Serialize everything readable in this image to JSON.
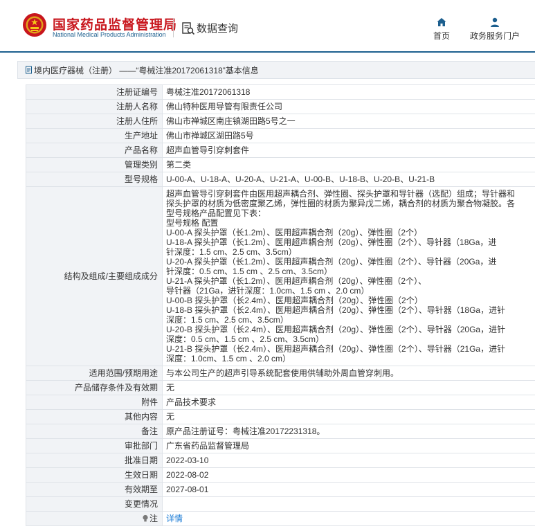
{
  "header": {
    "brand_cn": "国家药品监督管理局",
    "brand_en": "National Medical Products Administration",
    "data_query": "数据查询",
    "nav": {
      "home": "首页",
      "portal": "政务服务门户"
    }
  },
  "title_bar": {
    "text": "境内医疗器械（注册） ——“粤械注准20172061318”基本信息"
  },
  "rows": [
    {
      "label": "注册证编号",
      "value": "粤械注准20172061318"
    },
    {
      "label": "注册人名称",
      "value": "佛山特种医用导管有限责任公司"
    },
    {
      "label": "注册人住所",
      "value": "佛山市禅城区南庄镇湖田路5号之一"
    },
    {
      "label": "生产地址",
      "value": "佛山市禅城区湖田路5号"
    },
    {
      "label": "产品名称",
      "value": "超声血管导引穿刺套件"
    },
    {
      "label": "管理类别",
      "value": "第二类"
    },
    {
      "label": "型号规格",
      "value": "U-00-A、U-18-A、U-20-A、U-21-A、U-00-B、U-18-B、U-20-B、U-21-B"
    }
  ],
  "structure": {
    "label": "结构及组成/主要组成成分",
    "lines": [
      "超声血管导引穿刺套件由医用超声耦合剂、弹性圈、探头护罩和导针器（选配）组成；导针器和",
      "探头护罩的材质为低密度聚乙烯，弹性圈的材质为聚异戊二烯，耦合剂的材质为聚合物凝胶。各",
      "型号规格产品配置见下表：",
      "型号规格 配置",
      "U-00-A 探头护罩（长1.2m）、医用超声耦合剂（20g）、弹性圈（2个）",
      "U-18-A 探头护罩（长1.2m）、医用超声耦合剂（20g）、弹性圈（2个）、导针器（18Ga，进",
      "针深度：1.5 cm、2.5 cm、3.5cm）",
      "U-20-A 探头护罩（长1.2m）、医用超声耦合剂（20g）、弹性圈（2个）、导针器（20Ga，进",
      "针深度：0.5 cm、1.5 cm 、2.5 cm、3.5cm）",
      "U-21-A 探头护罩（长1.2m）、医用超声耦合剂（20g）、弹性圈（2个）、",
      "导针器（21Ga，进针深度：1.0cm、1.5 cm 、2.0 cm）",
      "U-00-B 探头护罩（长2.4m）、医用超声耦合剂（20g）、弹性圈（2个）",
      "U-18-B 探头护罩（长2.4m）、医用超声耦合剂（20g）、弹性圈（2个）、导针器（18Ga，进针",
      "深度：1.5 cm、2.5 cm、3.5cm）",
      "U-20-B 探头护罩（长2.4m）、医用超声耦合剂（20g）、弹性圈（2个）、导针器（20Ga，进针",
      "深度：0.5 cm、1.5 cm 、2.5 cm、3.5cm）",
      "U-21-B 探头护罩（长2.4m）、医用超声耦合剂（20g）、弹性圈（2个）、导针器（21Ga，进针",
      "深度：1.0cm、1.5 cm 、2.0 cm）"
    ]
  },
  "rows2": [
    {
      "label": "适用范围/预期用途",
      "value": "与本公司生产的超声引导系统配套使用供辅助外周血管穿刺用。"
    },
    {
      "label": "产品储存条件及有效期",
      "value": "无"
    },
    {
      "label": "附件",
      "value": "产品技术要求"
    },
    {
      "label": "其他内容",
      "value": "无"
    },
    {
      "label": "备注",
      "value": "原产品注册证号：粤械注准20172231318。"
    },
    {
      "label": "审批部门",
      "value": "广东省药品监督管理局"
    },
    {
      "label": "批准日期",
      "value": "2022-03-10"
    },
    {
      "label": "生效日期",
      "value": "2022-08-02"
    },
    {
      "label": "有效期至",
      "value": "2027-08-01"
    },
    {
      "label": "变更情况",
      "value": ""
    }
  ],
  "note": {
    "label": "注",
    "link": "详情"
  },
  "colors": {
    "brand_red": "#c8161d",
    "brand_blue": "#1c5f8e",
    "link": "#1c7cd6"
  }
}
